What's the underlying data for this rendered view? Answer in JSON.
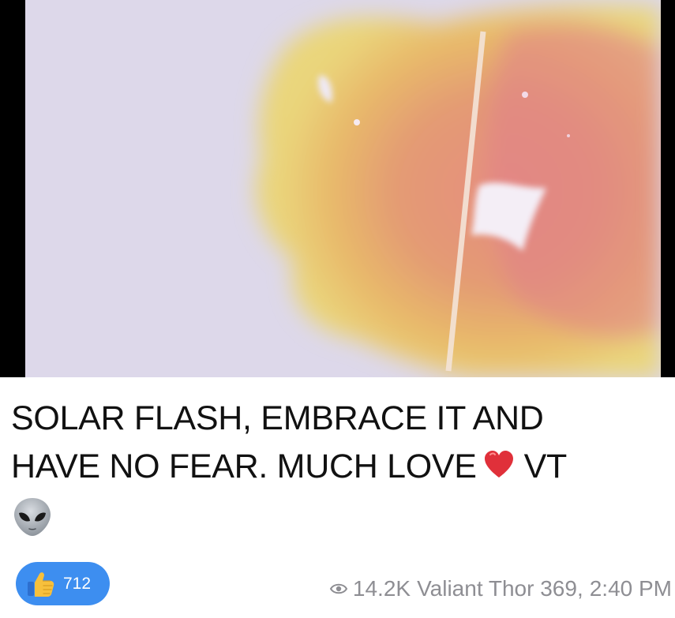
{
  "post": {
    "caption_line1": "SOLAR FLASH, EMBRACE IT AND",
    "caption_line2_a": "HAVE NO FEAR. MUCH LOVE",
    "caption_line2_b": "VT",
    "emoji_heart": "red-heart",
    "emoji_alien": "alien"
  },
  "reaction": {
    "icon": "thumbs-up",
    "count": "712"
  },
  "meta": {
    "views": "14.2K",
    "author": "Valiant Thor 369,",
    "time": "2:40 PM"
  },
  "colors": {
    "reaction_bg": "#3d8ef0",
    "meta_text": "#8e8e93",
    "caption_text": "#111111",
    "media_bg": "#ddd8ea"
  }
}
